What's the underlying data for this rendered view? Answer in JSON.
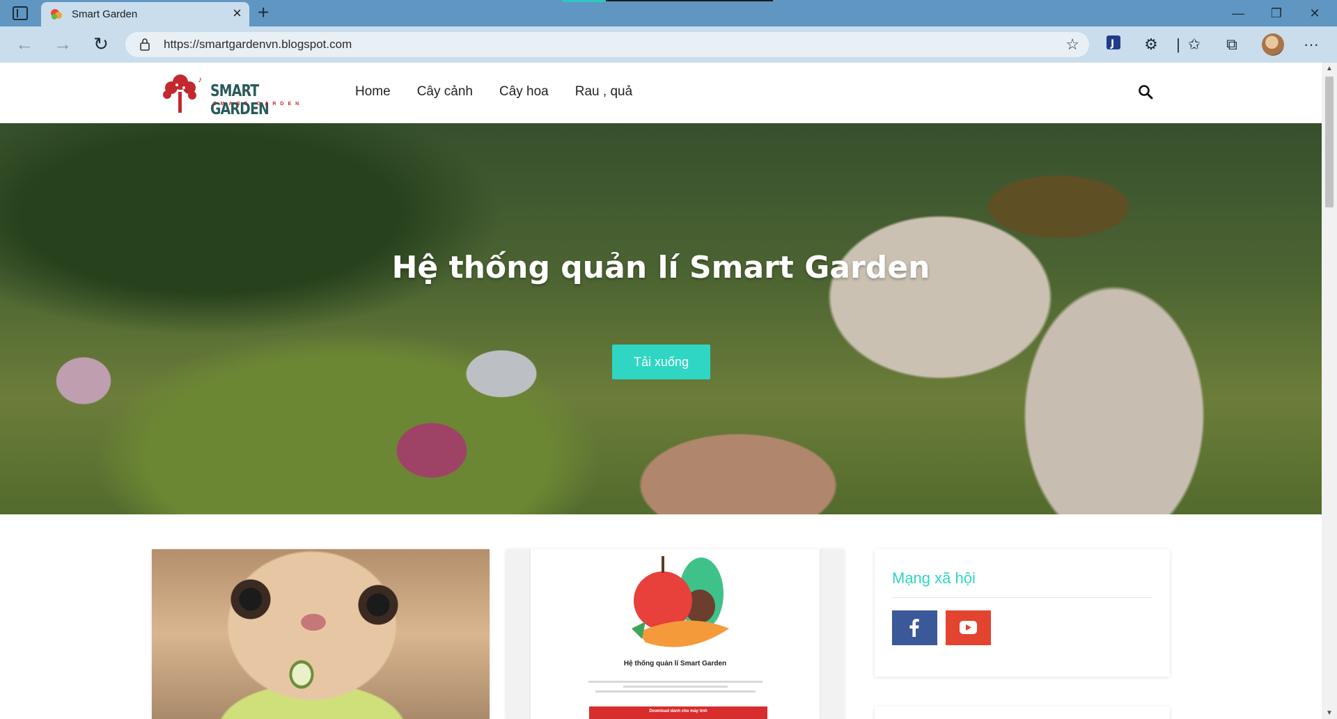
{
  "browser": {
    "tab_title": "Smart Garden",
    "tab_close": "×",
    "new_tab": "+",
    "url": "https://smartgardenvn.blogspot.com",
    "window_controls": [
      "—",
      "❐",
      "✕"
    ]
  },
  "site": {
    "logo_text": "SMART GARDEN",
    "logo_subtext": "SMART GARDEN",
    "menu": [
      "Home",
      "Cây cảnh",
      "Cây hoa",
      "Rau , quả"
    ],
    "hero": {
      "title": "Hệ thống quản lí Smart Garden",
      "button": "Tải xuống"
    },
    "doc_card": {
      "title": "Hệ thống quản lí Smart Garden",
      "button": "Download dành cho máy tính"
    },
    "social": {
      "title": "Mạng xã hội",
      "facebook_label": "f",
      "youtube_icon": "youtube-icon"
    }
  },
  "colors": {
    "accent": "#2fd6c3",
    "facebook": "#3b5998",
    "youtube": "#e3442f",
    "chrome": "#5f97c2"
  }
}
